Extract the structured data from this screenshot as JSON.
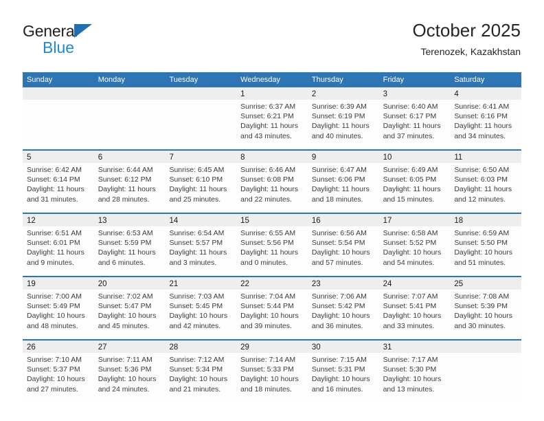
{
  "brand": {
    "name_part1": "General",
    "name_part2": "Blue"
  },
  "header": {
    "title": "October 2025",
    "subtitle": "Terenozek, Kazakhstan"
  },
  "colors": {
    "header_blue": "#2e75b6",
    "brand_blue": "#1f87d4",
    "brand_triangle": "#1f6fb5",
    "day_band": "#eeeeee",
    "text": "#3a3a3a"
  },
  "weekdays": [
    "Sunday",
    "Monday",
    "Tuesday",
    "Wednesday",
    "Thursday",
    "Friday",
    "Saturday"
  ],
  "weeks": [
    [
      {
        "empty": true
      },
      {
        "empty": true
      },
      {
        "empty": true
      },
      {
        "day": "1",
        "sunrise": "Sunrise: 6:37 AM",
        "sunset": "Sunset: 6:21 PM",
        "daylight1": "Daylight: 11 hours",
        "daylight2": "and 43 minutes."
      },
      {
        "day": "2",
        "sunrise": "Sunrise: 6:39 AM",
        "sunset": "Sunset: 6:19 PM",
        "daylight1": "Daylight: 11 hours",
        "daylight2": "and 40 minutes."
      },
      {
        "day": "3",
        "sunrise": "Sunrise: 6:40 AM",
        "sunset": "Sunset: 6:17 PM",
        "daylight1": "Daylight: 11 hours",
        "daylight2": "and 37 minutes."
      },
      {
        "day": "4",
        "sunrise": "Sunrise: 6:41 AM",
        "sunset": "Sunset: 6:16 PM",
        "daylight1": "Daylight: 11 hours",
        "daylight2": "and 34 minutes."
      }
    ],
    [
      {
        "day": "5",
        "sunrise": "Sunrise: 6:42 AM",
        "sunset": "Sunset: 6:14 PM",
        "daylight1": "Daylight: 11 hours",
        "daylight2": "and 31 minutes."
      },
      {
        "day": "6",
        "sunrise": "Sunrise: 6:44 AM",
        "sunset": "Sunset: 6:12 PM",
        "daylight1": "Daylight: 11 hours",
        "daylight2": "and 28 minutes."
      },
      {
        "day": "7",
        "sunrise": "Sunrise: 6:45 AM",
        "sunset": "Sunset: 6:10 PM",
        "daylight1": "Daylight: 11 hours",
        "daylight2": "and 25 minutes."
      },
      {
        "day": "8",
        "sunrise": "Sunrise: 6:46 AM",
        "sunset": "Sunset: 6:08 PM",
        "daylight1": "Daylight: 11 hours",
        "daylight2": "and 22 minutes."
      },
      {
        "day": "9",
        "sunrise": "Sunrise: 6:47 AM",
        "sunset": "Sunset: 6:06 PM",
        "daylight1": "Daylight: 11 hours",
        "daylight2": "and 18 minutes."
      },
      {
        "day": "10",
        "sunrise": "Sunrise: 6:49 AM",
        "sunset": "Sunset: 6:05 PM",
        "daylight1": "Daylight: 11 hours",
        "daylight2": "and 15 minutes."
      },
      {
        "day": "11",
        "sunrise": "Sunrise: 6:50 AM",
        "sunset": "Sunset: 6:03 PM",
        "daylight1": "Daylight: 11 hours",
        "daylight2": "and 12 minutes."
      }
    ],
    [
      {
        "day": "12",
        "sunrise": "Sunrise: 6:51 AM",
        "sunset": "Sunset: 6:01 PM",
        "daylight1": "Daylight: 11 hours",
        "daylight2": "and 9 minutes."
      },
      {
        "day": "13",
        "sunrise": "Sunrise: 6:53 AM",
        "sunset": "Sunset: 5:59 PM",
        "daylight1": "Daylight: 11 hours",
        "daylight2": "and 6 minutes."
      },
      {
        "day": "14",
        "sunrise": "Sunrise: 6:54 AM",
        "sunset": "Sunset: 5:57 PM",
        "daylight1": "Daylight: 11 hours",
        "daylight2": "and 3 minutes."
      },
      {
        "day": "15",
        "sunrise": "Sunrise: 6:55 AM",
        "sunset": "Sunset: 5:56 PM",
        "daylight1": "Daylight: 11 hours",
        "daylight2": "and 0 minutes."
      },
      {
        "day": "16",
        "sunrise": "Sunrise: 6:56 AM",
        "sunset": "Sunset: 5:54 PM",
        "daylight1": "Daylight: 10 hours",
        "daylight2": "and 57 minutes."
      },
      {
        "day": "17",
        "sunrise": "Sunrise: 6:58 AM",
        "sunset": "Sunset: 5:52 PM",
        "daylight1": "Daylight: 10 hours",
        "daylight2": "and 54 minutes."
      },
      {
        "day": "18",
        "sunrise": "Sunrise: 6:59 AM",
        "sunset": "Sunset: 5:50 PM",
        "daylight1": "Daylight: 10 hours",
        "daylight2": "and 51 minutes."
      }
    ],
    [
      {
        "day": "19",
        "sunrise": "Sunrise: 7:00 AM",
        "sunset": "Sunset: 5:49 PM",
        "daylight1": "Daylight: 10 hours",
        "daylight2": "and 48 minutes."
      },
      {
        "day": "20",
        "sunrise": "Sunrise: 7:02 AM",
        "sunset": "Sunset: 5:47 PM",
        "daylight1": "Daylight: 10 hours",
        "daylight2": "and 45 minutes."
      },
      {
        "day": "21",
        "sunrise": "Sunrise: 7:03 AM",
        "sunset": "Sunset: 5:45 PM",
        "daylight1": "Daylight: 10 hours",
        "daylight2": "and 42 minutes."
      },
      {
        "day": "22",
        "sunrise": "Sunrise: 7:04 AM",
        "sunset": "Sunset: 5:44 PM",
        "daylight1": "Daylight: 10 hours",
        "daylight2": "and 39 minutes."
      },
      {
        "day": "23",
        "sunrise": "Sunrise: 7:06 AM",
        "sunset": "Sunset: 5:42 PM",
        "daylight1": "Daylight: 10 hours",
        "daylight2": "and 36 minutes."
      },
      {
        "day": "24",
        "sunrise": "Sunrise: 7:07 AM",
        "sunset": "Sunset: 5:41 PM",
        "daylight1": "Daylight: 10 hours",
        "daylight2": "and 33 minutes."
      },
      {
        "day": "25",
        "sunrise": "Sunrise: 7:08 AM",
        "sunset": "Sunset: 5:39 PM",
        "daylight1": "Daylight: 10 hours",
        "daylight2": "and 30 minutes."
      }
    ],
    [
      {
        "day": "26",
        "sunrise": "Sunrise: 7:10 AM",
        "sunset": "Sunset: 5:37 PM",
        "daylight1": "Daylight: 10 hours",
        "daylight2": "and 27 minutes."
      },
      {
        "day": "27",
        "sunrise": "Sunrise: 7:11 AM",
        "sunset": "Sunset: 5:36 PM",
        "daylight1": "Daylight: 10 hours",
        "daylight2": "and 24 minutes."
      },
      {
        "day": "28",
        "sunrise": "Sunrise: 7:12 AM",
        "sunset": "Sunset: 5:34 PM",
        "daylight1": "Daylight: 10 hours",
        "daylight2": "and 21 minutes."
      },
      {
        "day": "29",
        "sunrise": "Sunrise: 7:14 AM",
        "sunset": "Sunset: 5:33 PM",
        "daylight1": "Daylight: 10 hours",
        "daylight2": "and 18 minutes."
      },
      {
        "day": "30",
        "sunrise": "Sunrise: 7:15 AM",
        "sunset": "Sunset: 5:31 PM",
        "daylight1": "Daylight: 10 hours",
        "daylight2": "and 16 minutes."
      },
      {
        "day": "31",
        "sunrise": "Sunrise: 7:17 AM",
        "sunset": "Sunset: 5:30 PM",
        "daylight1": "Daylight: 10 hours",
        "daylight2": "and 13 minutes."
      },
      {
        "empty": true
      }
    ]
  ]
}
